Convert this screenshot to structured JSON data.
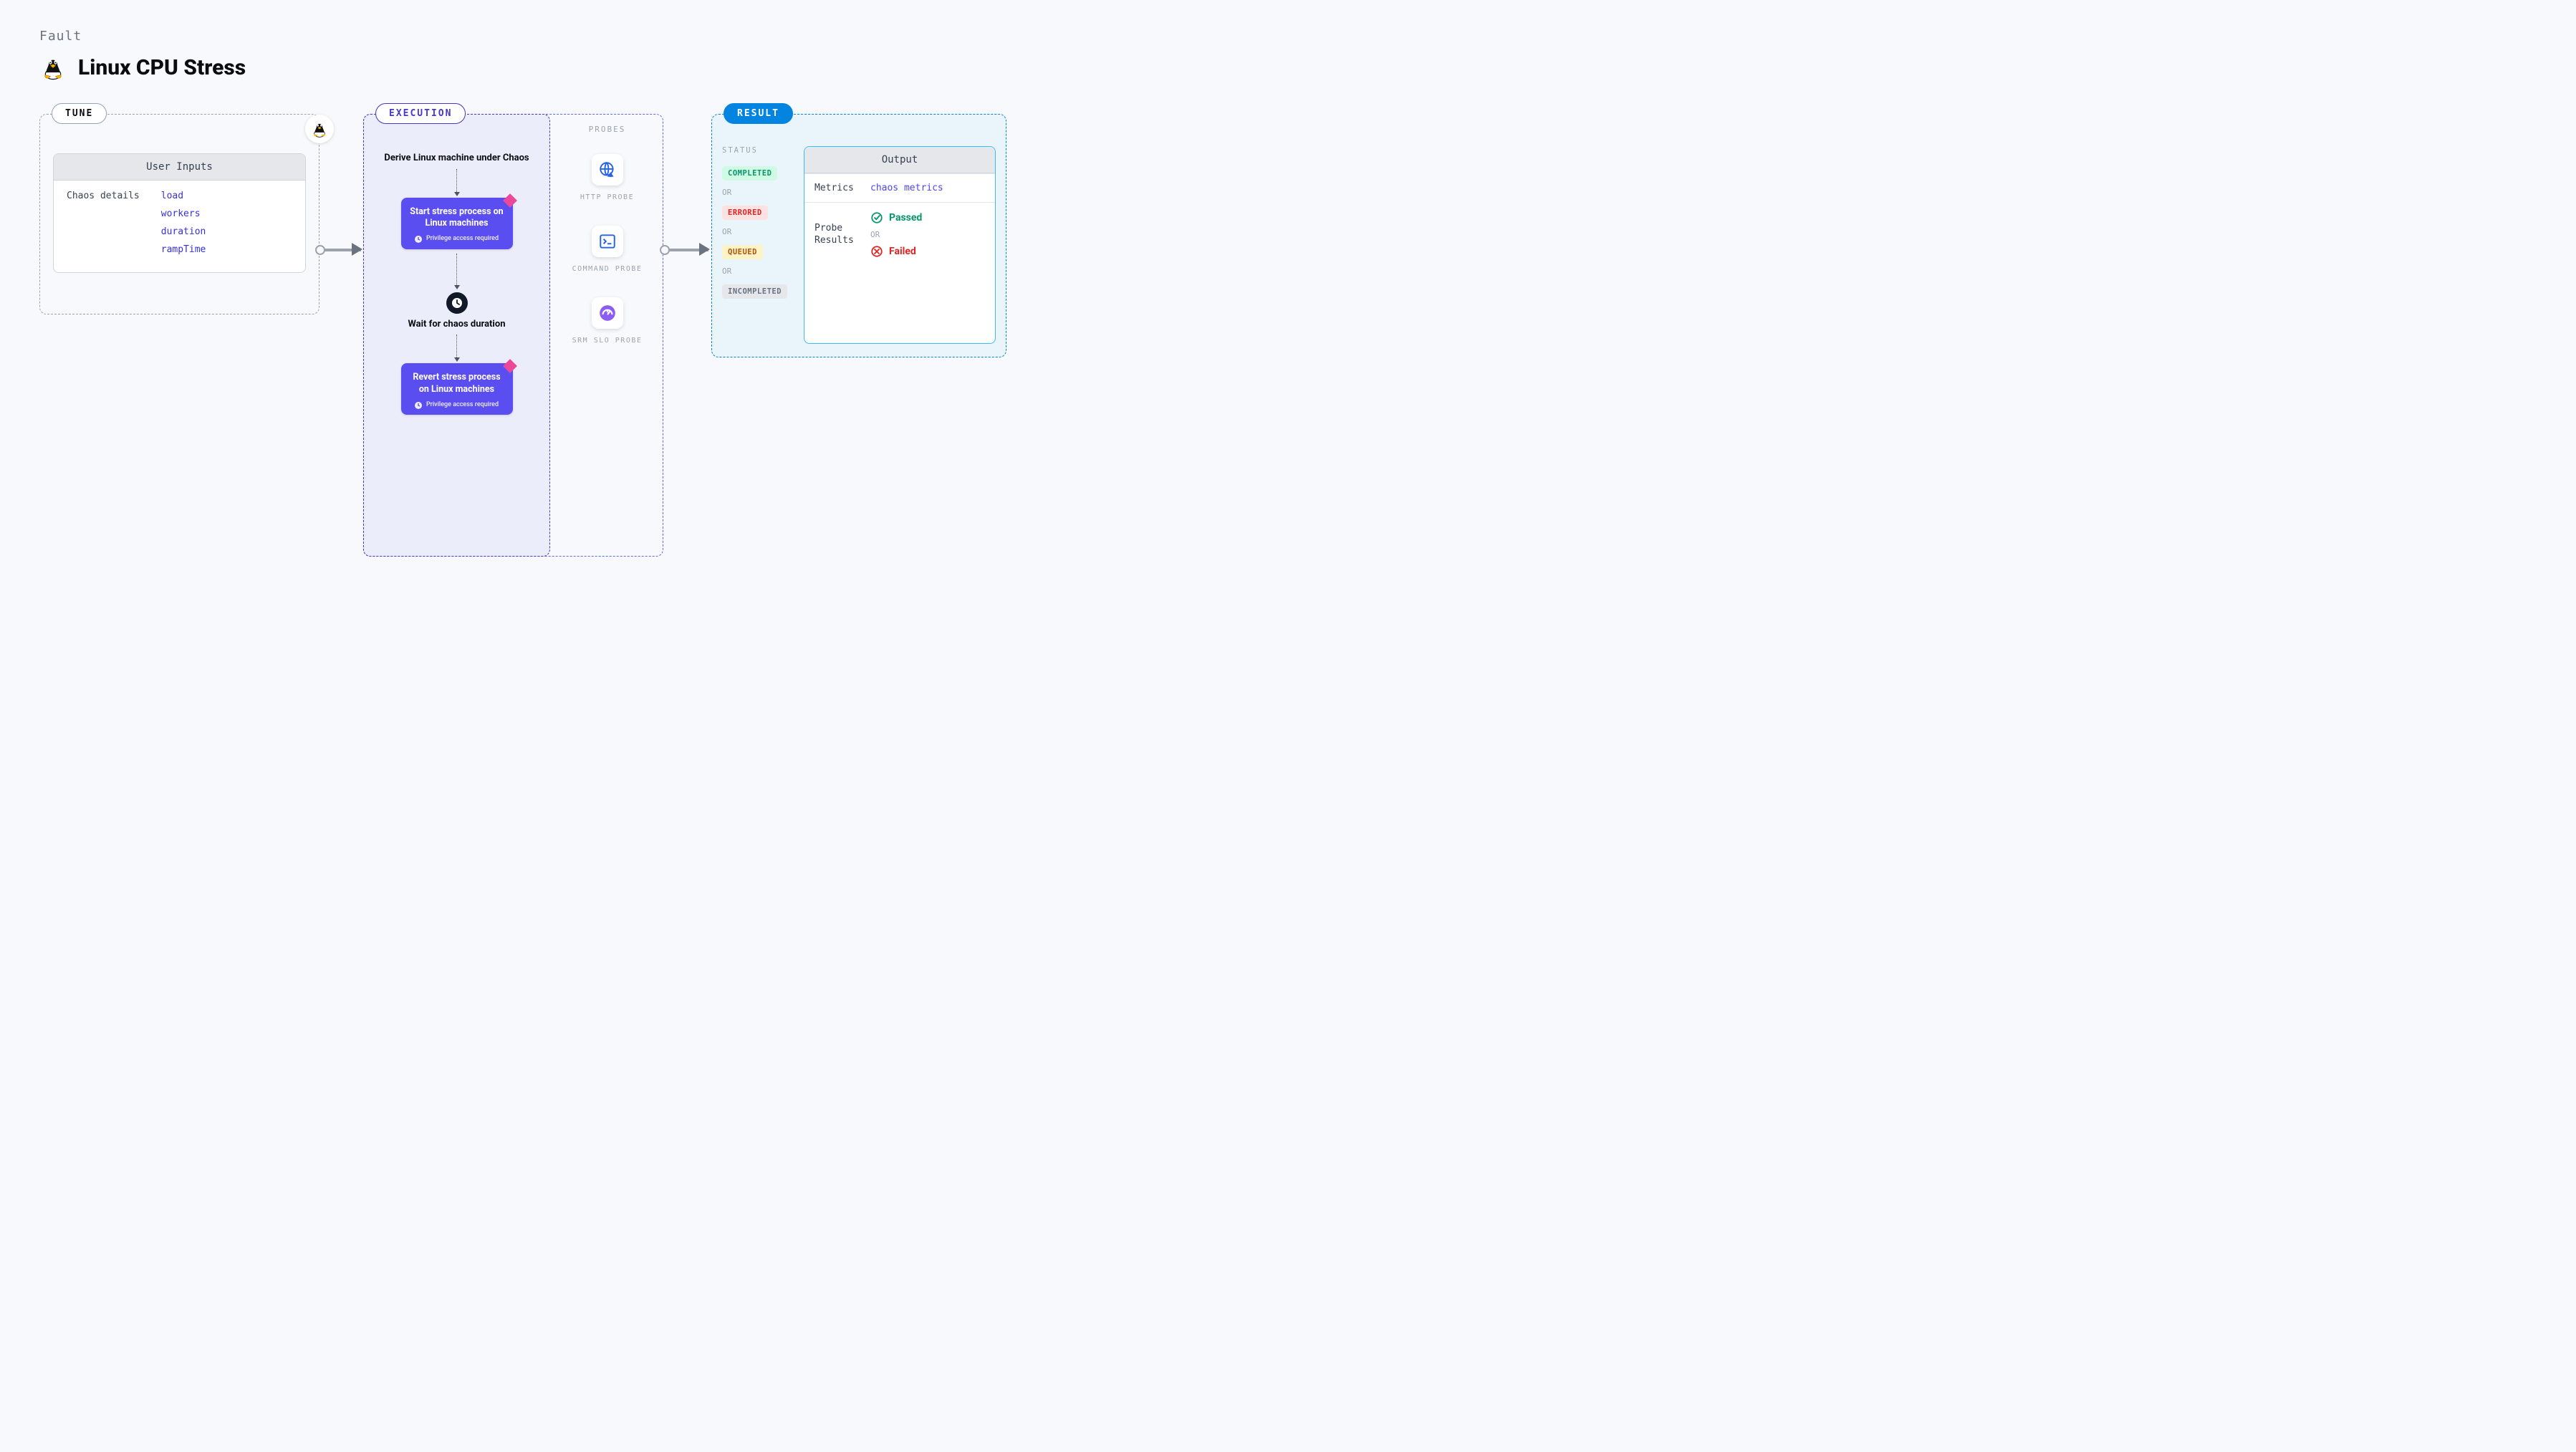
{
  "kicker": "Fault",
  "title": "Linux CPU Stress",
  "tune": {
    "pill": "TUNE",
    "card_title": "User Inputs",
    "row_label": "Chaos details",
    "params": [
      "load",
      "workers",
      "duration",
      "rampTime"
    ]
  },
  "execution": {
    "pill": "EXECUTION",
    "step1": "Derive Linux machine under Chaos",
    "action1": "Start stress process on Linux machines",
    "privilege": "Privilege access required",
    "wait": "Wait for chaos duration",
    "action2": "Revert stress process on Linux machines"
  },
  "probes": {
    "heading": "PROBES",
    "items": [
      {
        "name": "HTTP PROBE",
        "icon": "globe"
      },
      {
        "name": "COMMAND PROBE",
        "icon": "terminal"
      },
      {
        "name": "SRM SLO PROBE",
        "icon": "gauge"
      }
    ]
  },
  "result": {
    "pill": "RESULT",
    "status_heading": "STATUS",
    "statuses": [
      "COMPLETED",
      "ERRORED",
      "QUEUED",
      "INCOMPLETED"
    ],
    "or": "OR",
    "output_title": "Output",
    "metrics_label": "Metrics",
    "metrics_value": "chaos metrics",
    "probe_results_label": "Probe Results",
    "passed": "Passed",
    "failed": "Failed"
  }
}
